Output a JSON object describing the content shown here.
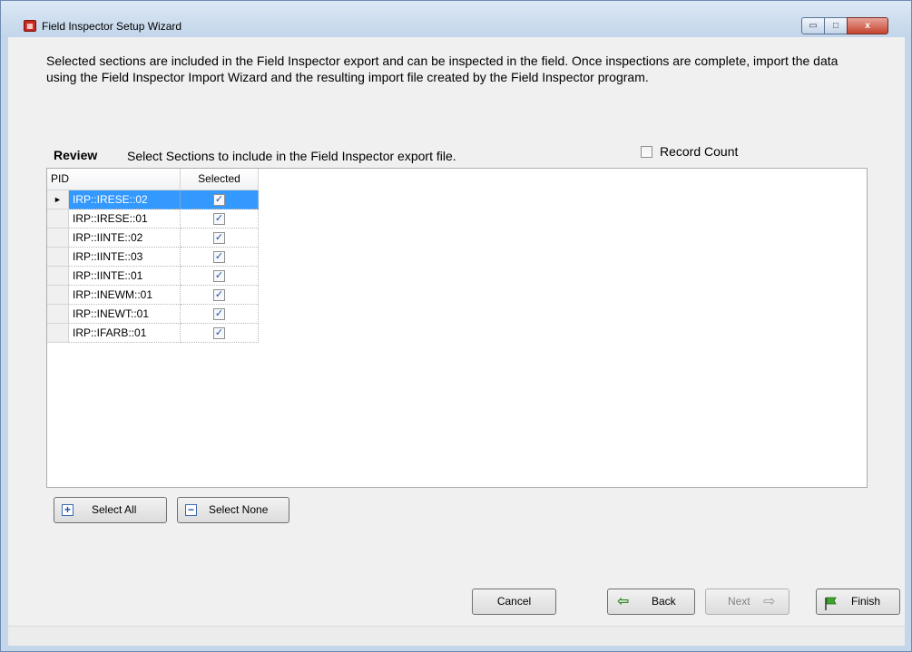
{
  "window": {
    "title": "Field Inspector Setup Wizard",
    "minimize_glyph": "▭",
    "maximize_glyph": "□",
    "close_glyph": "x"
  },
  "intro": {
    "text": "Selected sections are included in the Field Inspector export and can be inspected in the field.  Once inspections are complete, import the data using the Field Inspector Import Wizard and the resulting import file created by the Field Inspector program."
  },
  "review": {
    "title": "Review",
    "subtitle": "Select Sections to include in the Field Inspector export file."
  },
  "record_count": {
    "label": "Record Count",
    "checked": false
  },
  "grid": {
    "columns": [
      "PID",
      "Selected"
    ],
    "current_row_marker": "►",
    "rows": [
      {
        "pid": "IRP::IRESE::02",
        "selected": true
      },
      {
        "pid": "IRP::IRESE::01",
        "selected": true
      },
      {
        "pid": "IRP::IINTE::02",
        "selected": true
      },
      {
        "pid": "IRP::IINTE::03",
        "selected": true
      },
      {
        "pid": "IRP::IINTE::01",
        "selected": true
      },
      {
        "pid": "IRP::INEWM::01",
        "selected": true
      },
      {
        "pid": "IRP::INEWT::01",
        "selected": true
      },
      {
        "pid": "IRP::IFARB::01",
        "selected": true
      }
    ]
  },
  "buttons": {
    "select_all": "Select All",
    "select_none": "Select None",
    "cancel": "Cancel",
    "back": "Back",
    "next": "Next",
    "finish": "Finish"
  },
  "icons": {
    "app": "app-icon",
    "plus": "+",
    "minus": "−",
    "back_arrow": "⇦",
    "next_arrow": "⇨"
  },
  "colors": {
    "selection": "#3399ff",
    "finish_flag": "#3fa52a"
  }
}
